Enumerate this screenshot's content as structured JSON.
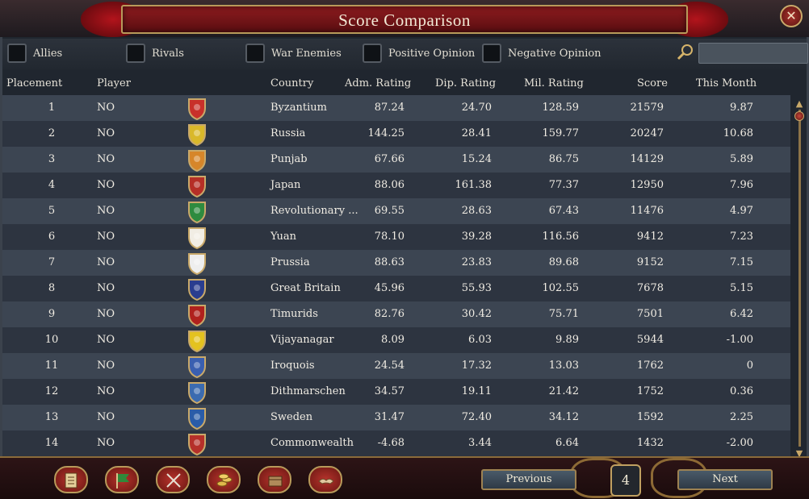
{
  "window": {
    "title": "Score Comparison",
    "close_label": "✕"
  },
  "filters": [
    {
      "label": "Allies"
    },
    {
      "label": "Rivals"
    },
    {
      "label": "War Enemies"
    },
    {
      "label": "Positive Opinion"
    },
    {
      "label": "Negative Opinion"
    }
  ],
  "search": {
    "value": ""
  },
  "columns": {
    "placement": "Placement",
    "player": "Player",
    "country": "Country",
    "adm": "Adm. Rating",
    "dip": "Dip. Rating",
    "mil": "Mil. Rating",
    "score": "Score",
    "month": "This Month"
  },
  "rows": [
    {
      "placement": "1",
      "player": "NO",
      "flag_icon": "byzantium-flag-icon",
      "flag_color": "#c8302a",
      "country": "Byzantium",
      "adm": "87.24",
      "dip": "24.70",
      "mil": "128.59",
      "score": "21579",
      "month": "9.87"
    },
    {
      "placement": "2",
      "player": "NO",
      "flag_icon": "russia-flag-icon",
      "flag_color": "#d9b82a",
      "country": "Russia",
      "adm": "144.25",
      "dip": "28.41",
      "mil": "159.77",
      "score": "20247",
      "month": "10.68"
    },
    {
      "placement": "3",
      "player": "NO",
      "flag_icon": "punjab-flag-icon",
      "flag_color": "#d6862a",
      "country": "Punjab",
      "adm": "67.66",
      "dip": "15.24",
      "mil": "86.75",
      "score": "14129",
      "month": "5.89"
    },
    {
      "placement": "4",
      "player": "NO",
      "flag_icon": "japan-flag-icon",
      "flag_color": "#b52f26",
      "country": "Japan",
      "adm": "88.06",
      "dip": "161.38",
      "mil": "77.37",
      "score": "12950",
      "month": "7.96"
    },
    {
      "placement": "5",
      "player": "NO",
      "flag_icon": "revolutionary-flag-icon",
      "flag_color": "#2e8b3f",
      "country": "Revolutionary ...",
      "adm": "69.55",
      "dip": "28.63",
      "mil": "67.43",
      "score": "11476",
      "month": "4.97"
    },
    {
      "placement": "6",
      "player": "NO",
      "flag_icon": "yuan-flag-icon",
      "flag_color": "#f1ede4",
      "country": "Yuan",
      "adm": "78.10",
      "dip": "39.28",
      "mil": "116.56",
      "score": "9412",
      "month": "7.23"
    },
    {
      "placement": "7",
      "player": "NO",
      "flag_icon": "prussia-flag-icon",
      "flag_color": "#eeeeee",
      "country": "Prussia",
      "adm": "88.63",
      "dip": "23.83",
      "mil": "89.68",
      "score": "9152",
      "month": "7.15"
    },
    {
      "placement": "8",
      "player": "NO",
      "flag_icon": "great-britain-flag-icon",
      "flag_color": "#2a3d8f",
      "country": "Great Britain",
      "adm": "45.96",
      "dip": "55.93",
      "mil": "102.55",
      "score": "7678",
      "month": "5.15"
    },
    {
      "placement": "9",
      "player": "NO",
      "flag_icon": "timurids-flag-icon",
      "flag_color": "#b0211d",
      "country": "Timurids",
      "adm": "82.76",
      "dip": "30.42",
      "mil": "75.71",
      "score": "7501",
      "month": "6.42"
    },
    {
      "placement": "10",
      "player": "NO",
      "flag_icon": "vijayanagar-flag-icon",
      "flag_color": "#e4c21f",
      "country": "Vijayanagar",
      "adm": "8.09",
      "dip": "6.03",
      "mil": "9.89",
      "score": "5944",
      "month": "-1.00"
    },
    {
      "placement": "11",
      "player": "NO",
      "flag_icon": "iroquois-flag-icon",
      "flag_color": "#3a5fb0",
      "country": "Iroquois",
      "adm": "24.54",
      "dip": "17.32",
      "mil": "13.03",
      "score": "1762",
      "month": "0"
    },
    {
      "placement": "12",
      "player": "NO",
      "flag_icon": "dithmarschen-flag-icon",
      "flag_color": "#3b6bb0",
      "country": "Dithmarschen",
      "adm": "34.57",
      "dip": "19.11",
      "mil": "21.42",
      "score": "1752",
      "month": "0.36"
    },
    {
      "placement": "13",
      "player": "NO",
      "flag_icon": "sweden-flag-icon",
      "flag_color": "#2a5ca8",
      "country": "Sweden",
      "adm": "31.47",
      "dip": "72.40",
      "mil": "34.12",
      "score": "1592",
      "month": "2.25"
    },
    {
      "placement": "14",
      "player": "NO",
      "flag_icon": "commonwealth-flag-icon",
      "flag_color": "#b5302a",
      "country": "Commonwealth",
      "adm": "-4.68",
      "dip": "3.44",
      "mil": "6.64",
      "score": "1432",
      "month": "-2.00"
    }
  ],
  "toolbar": [
    {
      "icon": "ledger-icon"
    },
    {
      "icon": "flag-icon"
    },
    {
      "icon": "crossed-swords-icon"
    },
    {
      "icon": "coins-icon"
    },
    {
      "icon": "trade-goods-icon"
    },
    {
      "icon": "handshake-icon"
    }
  ],
  "pagination": {
    "previous_label": "Previous",
    "page": "4",
    "next_label": "Next"
  },
  "colors": {
    "accent": "#8c1b1e",
    "gold": "#b89a5a",
    "row_odd": "#3c4552",
    "row_even": "#2d3440"
  }
}
